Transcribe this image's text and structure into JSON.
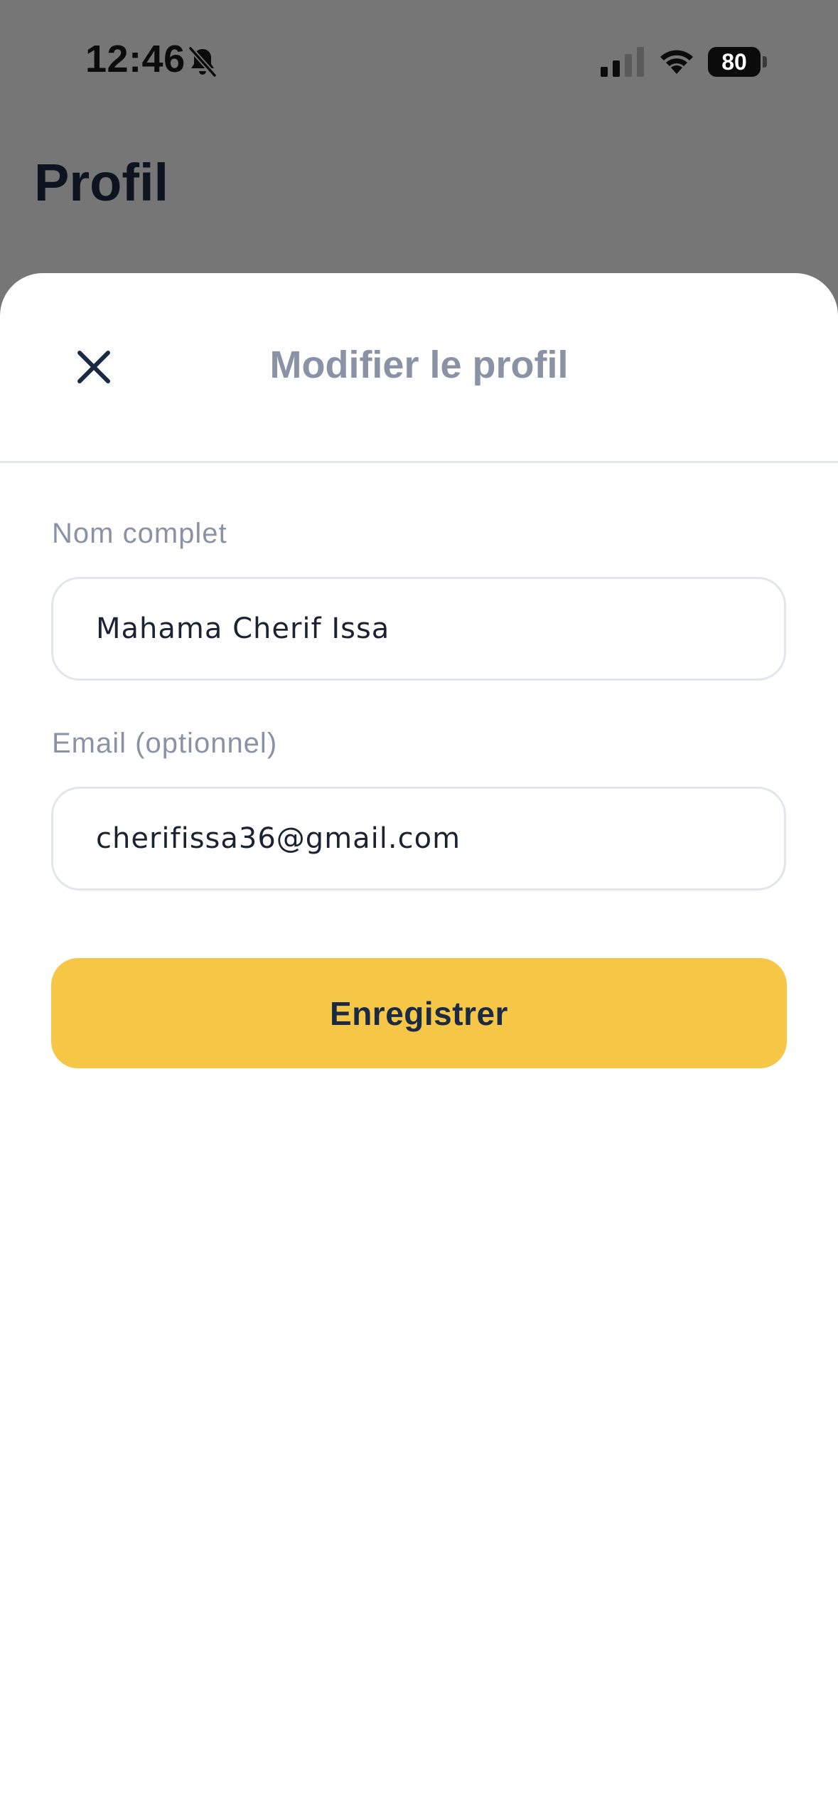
{
  "status_bar": {
    "time": "12:46",
    "battery_level": "80",
    "icons": [
      "bell-slash-icon",
      "cellular-signal-icon",
      "wifi-icon",
      "battery-icon"
    ]
  },
  "background_page": {
    "title": "Profil"
  },
  "sheet": {
    "title": "Modifier le profil",
    "close_icon": "close-icon"
  },
  "form": {
    "full_name": {
      "label": "Nom complet",
      "value": "Mahama Cherif Issa"
    },
    "email": {
      "label": "Email (optionnel)",
      "value": "cherifissa36@gmail.com"
    },
    "save_label": "Enregistrer"
  },
  "colors": {
    "overlay": "#767676",
    "accent": "#f6c646",
    "label_gray": "#8a93a6",
    "text_dark": "#1b2a44",
    "border": "#e2e5eb"
  }
}
